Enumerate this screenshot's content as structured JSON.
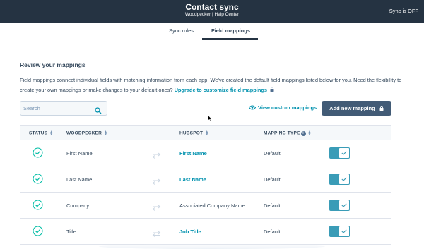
{
  "header": {
    "title": "Contact sync",
    "subtitle": "Woodpecker | Help Center",
    "sync_status": "Sync is OFF"
  },
  "tabs": [
    {
      "label": "Sync rules",
      "active": false
    },
    {
      "label": "Field mappings",
      "active": true
    }
  ],
  "section": {
    "heading": "Review your mappings",
    "description": "Field mappings connect individual fields with matching information from each app. We've created the default field mappings listed below for you. Need the flexibility to create your own mappings or make changes to your default ones?",
    "upgrade_link": "Upgrade to customize field mappings"
  },
  "toolbar": {
    "search_placeholder": "Search",
    "view_custom_label": "View custom mappings",
    "add_button_label": "Add new mapping"
  },
  "table": {
    "columns": [
      "STATUS",
      "WOODPECKER",
      "HUBSPOT",
      "MAPPING TYPE"
    ],
    "rows": [
      {
        "woodpecker": "First Name",
        "hubspot": "First Name",
        "hubspot_is_link": true,
        "mapping_type": "Default",
        "enabled": true
      },
      {
        "woodpecker": "Last Name",
        "hubspot": "Last Name",
        "hubspot_is_link": true,
        "mapping_type": "Default",
        "enabled": true
      },
      {
        "woodpecker": "Company",
        "hubspot": "Associated Company Name",
        "hubspot_is_link": false,
        "mapping_type": "Default",
        "enabled": true
      },
      {
        "woodpecker": "Title",
        "hubspot": "Job Title",
        "hubspot_is_link": true,
        "mapping_type": "Default",
        "enabled": true
      }
    ]
  },
  "colors": {
    "header_bg": "#253342",
    "link": "#0091ae",
    "toggle_on": "#3a9cb7",
    "check": "#00bda5",
    "button_bg": "#425b76"
  }
}
